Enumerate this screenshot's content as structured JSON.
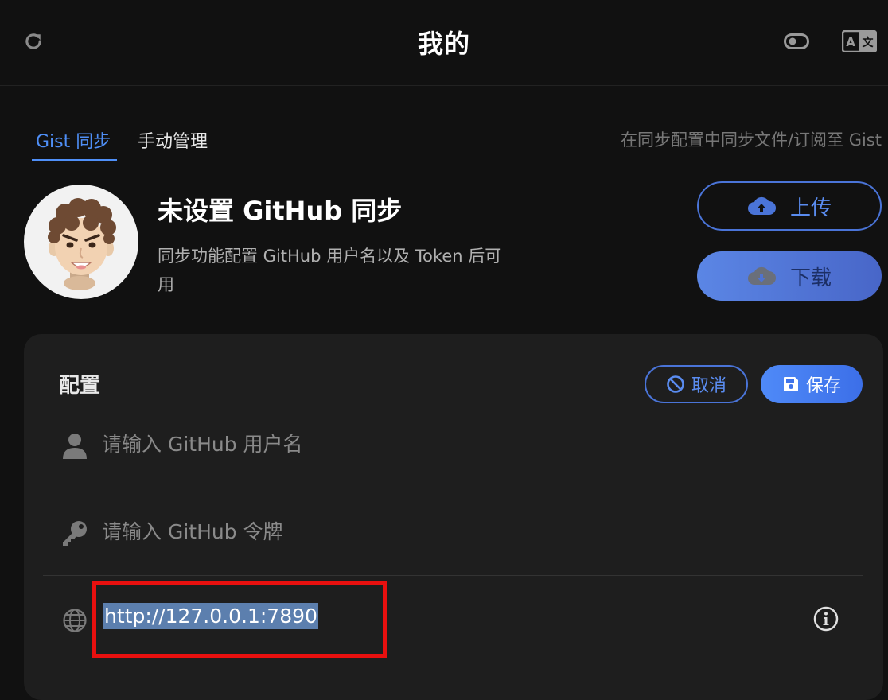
{
  "header": {
    "title": "我的",
    "icons": {
      "refresh": "refresh-icon",
      "toggle": "toggle-icon",
      "translate": "translate-icon"
    },
    "translate_icon_text": {
      "a": "A",
      "zh": "文"
    }
  },
  "tabs": [
    {
      "label": "Gist 同步",
      "active": true
    },
    {
      "label": "手动管理",
      "active": false
    }
  ],
  "tab_hint": "在同步配置中同步文件/订阅至 Gist",
  "profile": {
    "title": "未设置 GitHub 同步",
    "description": "同步功能配置 GitHub 用户名以及 Token 后可用"
  },
  "actions": {
    "upload_label": "上传",
    "download_label": "下载"
  },
  "config": {
    "title": "配置",
    "cancel_label": "取消",
    "save_label": "保存",
    "username_placeholder": "请输入 GitHub 用户名",
    "token_placeholder": "请输入 GitHub 令牌",
    "proxy_value": "http://127.0.0.1:7890"
  },
  "colors": {
    "accent": "#4f8ff7",
    "background": "#111111",
    "card": "#1e1e1e",
    "highlight": "#e8100f",
    "selection": "#5c7fae"
  }
}
